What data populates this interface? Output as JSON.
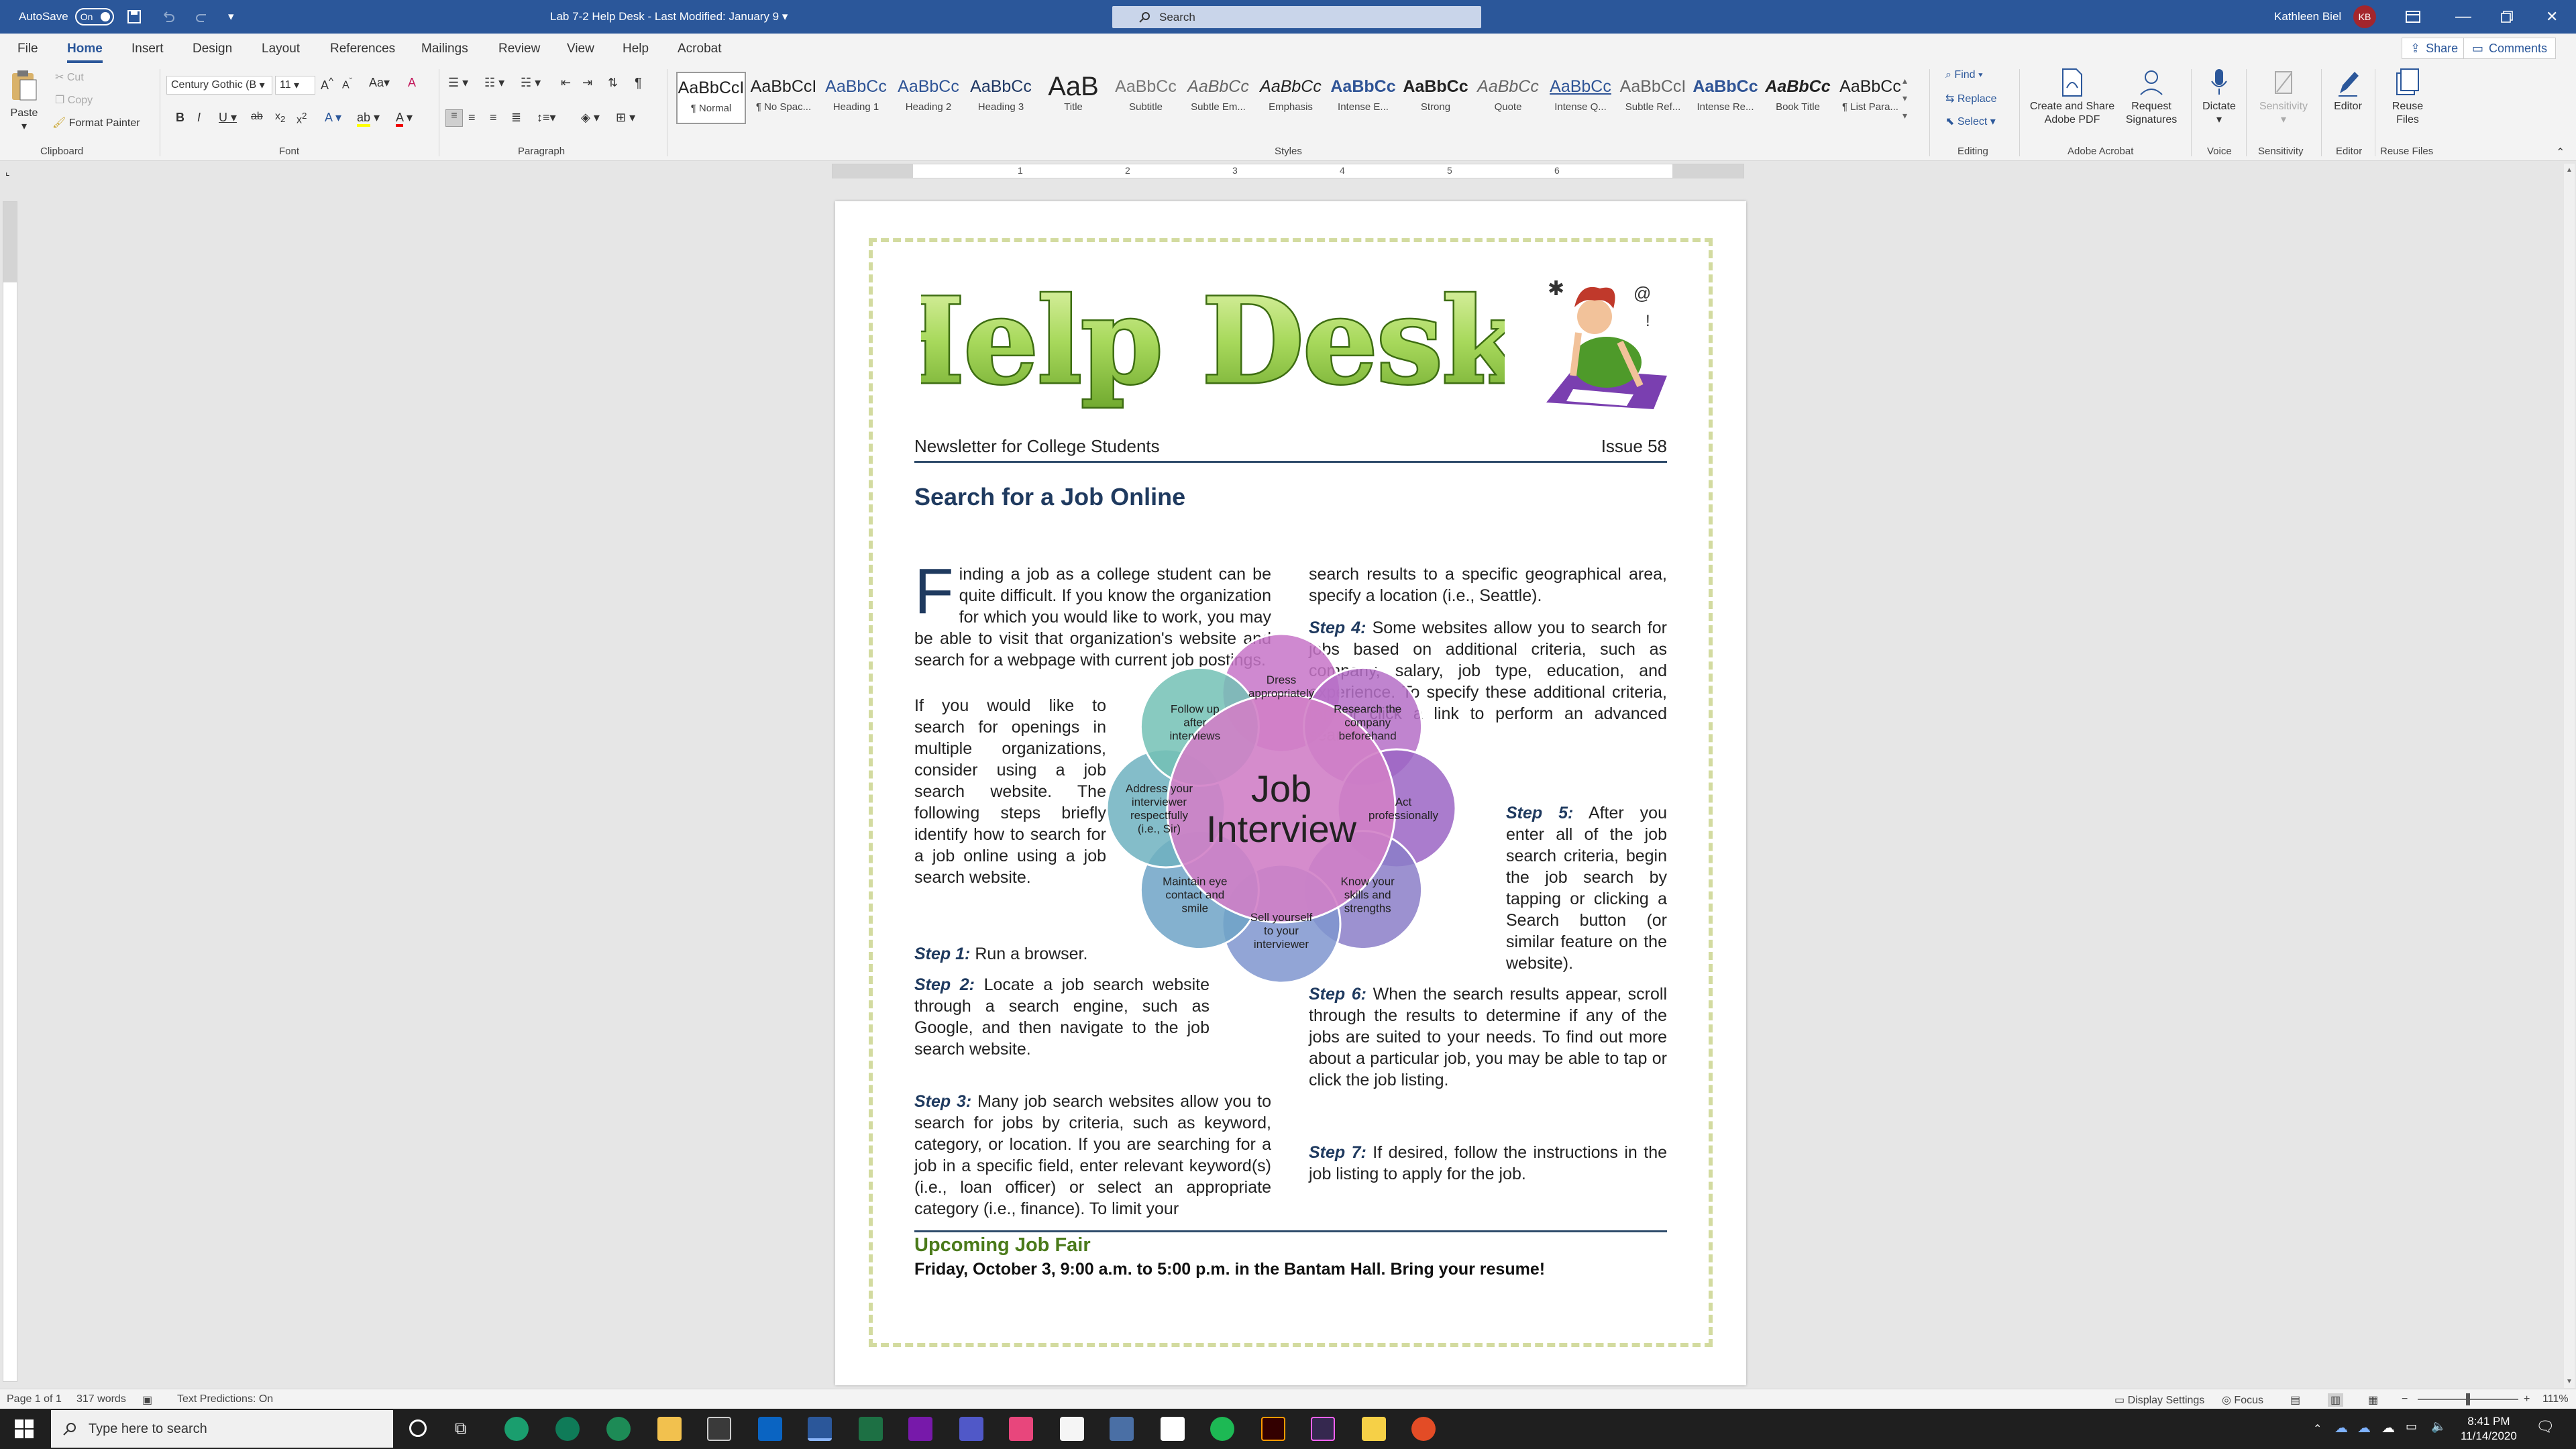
{
  "titlebar": {
    "autosave_label": "AutoSave",
    "autosave_state": "On",
    "doc_title": "Lab 7-2 Help Desk  -  Last Modified: January 9",
    "search_placeholder": "Search",
    "user_name": "Kathleen Biel",
    "user_initials": "KB"
  },
  "tabs": [
    "File",
    "Home",
    "Insert",
    "Design",
    "Layout",
    "References",
    "Mailings",
    "Review",
    "View",
    "Help",
    "Acrobat"
  ],
  "active_tab": "Home",
  "share_label": "Share",
  "comments_label": "Comments",
  "clipboard": {
    "paste": "Paste",
    "cut": "Cut",
    "copy": "Copy",
    "format_painter": "Format Painter",
    "group": "Clipboard"
  },
  "font": {
    "name": "Century Gothic (B",
    "size": "11",
    "group": "Font"
  },
  "paragraph_group": "Paragraph",
  "styles": {
    "group": "Styles",
    "items": [
      {
        "preview": "AaBbCcI",
        "label": "¶ Normal"
      },
      {
        "preview": "AaBbCcI",
        "label": "¶ No Spac..."
      },
      {
        "preview": "AaBbCc",
        "label": "Heading 1"
      },
      {
        "preview": "AaBbCc",
        "label": "Heading 2"
      },
      {
        "preview": "AaBbCc",
        "label": "Heading 3"
      },
      {
        "preview": "AaB",
        "label": "Title"
      },
      {
        "preview": "AaBbCc",
        "label": "Subtitle"
      },
      {
        "preview": "AaBbCc",
        "label": "Subtle Em..."
      },
      {
        "preview": "AaBbCc",
        "label": "Emphasis"
      },
      {
        "preview": "AaBbCc",
        "label": "Intense E..."
      },
      {
        "preview": "AaBbCc",
        "label": "Strong"
      },
      {
        "preview": "AaBbCc",
        "label": "Quote"
      },
      {
        "preview": "AaBbCc",
        "label": "Intense Q..."
      },
      {
        "preview": "AaBbCcI",
        "label": "Subtle Ref..."
      },
      {
        "preview": "AaBbCc",
        "label": "Intense Re..."
      },
      {
        "preview": "AaBbCc",
        "label": "Book Title"
      },
      {
        "preview": "AaBbCc",
        "label": "¶ List Para..."
      }
    ]
  },
  "editing": {
    "find": "Find",
    "replace": "Replace",
    "select": "Select",
    "group": "Editing"
  },
  "acrobat": {
    "create_share": "Create and Share Adobe PDF",
    "request_sig": "Request Signatures",
    "group": "Adobe Acrobat"
  },
  "voice": {
    "dictate": "Dictate",
    "group": "Voice"
  },
  "sensitivity": {
    "label": "Sensitivity",
    "group": "Sensitivity"
  },
  "editor": {
    "label": "Editor",
    "group": "Editor"
  },
  "reuse": {
    "label": "Reuse Files",
    "group": "Reuse Files"
  },
  "ruler_numbers": [
    "1",
    "2",
    "3",
    "4",
    "5",
    "6"
  ],
  "doc": {
    "masthead": "Help Desk!",
    "newsletter": "Newsletter for College Students",
    "issue": "Issue 58",
    "title": "Search for a Job Online",
    "dropcap": "F",
    "intro_1": "inding a job as a college student can be quite difficult. If you know the organization for which you would like to work, you may be able to visit that organization's website and search for a webpage with current job postings.",
    "intro_2": "If you would like to search for openings in multiple organizations, consider using a job search website. The following steps briefly identify how to search for a job online using a job search website.",
    "steps": [
      {
        "label": "Step 1:",
        "text": "Run a browser."
      },
      {
        "label": "Step 2:",
        "text": "Locate a job search website through a search engine, such as Google, and then navigate to the job search website."
      },
      {
        "label": "Step 3:",
        "text": "Many job search websites allow you to search for jobs by criteria, such as keyword, category, or location. If you are searching for a job in a specific field, enter relevant keyword(s) (i.e., loan officer) or select an appropriate category (i.e., finance). To limit your"
      },
      {
        "label": "",
        "text": "search results to a specific geographical area, specify a location (i.e., Seattle)."
      },
      {
        "label": "Step 4:",
        "text": "Some websites allow you to search for jobs based on additional criteria, such as company, salary, job type, education, and experience. To specify these additional criteria, tap or click a link to perform an advanced search."
      },
      {
        "label": "Step 5:",
        "text": "After you enter all of the job search criteria, begin the job search by tapping or clicking a Search button (or similar feature on the website)."
      },
      {
        "label": "Step 6:",
        "text": "When the search results appear, scroll through the results to determine if any of the jobs are suited to your needs. To find out more about a particular job, you may be able to tap or click the job listing."
      },
      {
        "label": "Step 7:",
        "text": "If desired, follow the instructions in the job listing to apply for the job."
      }
    ],
    "diagram": {
      "center": "Job Interview",
      "petals": [
        "Dress appropriately",
        "Research the company beforehand",
        "Act professionally",
        "Know your skills and strengths",
        "Sell yourself to your interviewer",
        "Maintain eye contact and smile",
        "Address your interviewer respectfully (i.e., Sir)",
        "Follow up after interviews"
      ],
      "colors": [
        "#c774c8",
        "#b56fc7",
        "#9b65c4",
        "#8b7ec8",
        "#7f95cf",
        "#6fa3c7",
        "#6eb1c0",
        "#73c1b5"
      ],
      "center_color": "#d07fc6"
    },
    "fair_title": "Upcoming Job Fair",
    "fair_text": "Friday, October 3, 9:00 a.m. to 5:00 p.m. in the Bantam Hall. Bring your resume!"
  },
  "status": {
    "page": "Page 1 of 1",
    "words": "317 words",
    "predictions": "Text Predictions: On",
    "display": "Display Settings",
    "focus": "Focus",
    "zoom": "111%"
  },
  "taskbar": {
    "search_placeholder": "Type here to search",
    "time": "8:41 PM",
    "date": "11/14/2020"
  }
}
